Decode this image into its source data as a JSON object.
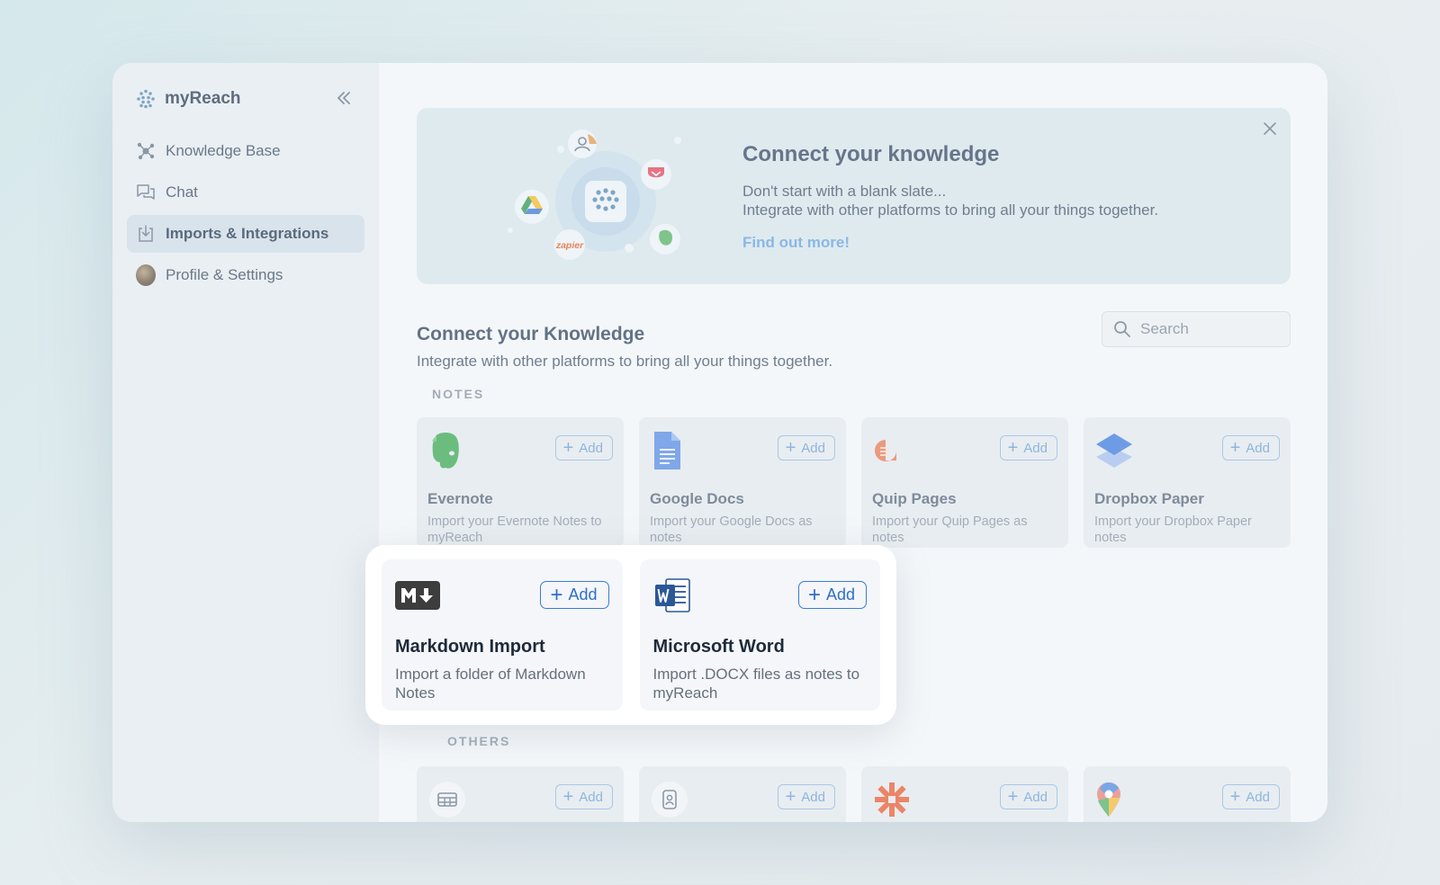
{
  "brand": {
    "name": "myReach"
  },
  "sidebar": {
    "items": [
      {
        "label": "Knowledge Base",
        "icon": "graph-icon"
      },
      {
        "label": "Chat",
        "icon": "chat-icon"
      },
      {
        "label": "Imports & Integrations",
        "icon": "import-icon",
        "active": true
      },
      {
        "label": "Profile & Settings",
        "icon": "avatar"
      }
    ]
  },
  "hero": {
    "title": "Connect your knowledge",
    "line1": "Don't start with a blank slate...",
    "line2": "Integrate with other platforms to bring all your things together.",
    "link": "Find out more!",
    "zapier_label": "zapier"
  },
  "section": {
    "title": "Connect your Knowledge",
    "subtitle": "Integrate with other platforms to bring all your things together."
  },
  "search": {
    "placeholder": "Search"
  },
  "categories": {
    "notes": "NOTES",
    "others": "OTHERS"
  },
  "add_label": "Add",
  "notes_cards": [
    {
      "title": "Evernote",
      "desc": "Import your Evernote Notes to myReach",
      "icon": "evernote-icon"
    },
    {
      "title": "Google Docs",
      "desc": "Import your Google Docs as notes",
      "icon": "google-docs-icon"
    },
    {
      "title": "Quip Pages",
      "desc": "Import your Quip Pages as notes",
      "icon": "quip-icon"
    },
    {
      "title": "Dropbox Paper",
      "desc": "Import your Dropbox Paper notes",
      "icon": "dropbox-paper-icon"
    }
  ],
  "highlight_cards": [
    {
      "title": "Markdown Import",
      "desc": "Import a folder of Markdown Notes",
      "icon": "markdown-icon"
    },
    {
      "title": "Microsoft Word",
      "desc": "Import .DOCX files as notes to myReach",
      "icon": "word-icon"
    }
  ],
  "others_cards": [
    {
      "icon": "table-icon"
    },
    {
      "icon": "contact-card-icon"
    },
    {
      "icon": "zapier-icon"
    },
    {
      "icon": "google-maps-icon"
    }
  ],
  "colors": {
    "accent": "#2d6fcb",
    "faded_accent": "#8eb5de",
    "sidebar_active": "#d9e3ec"
  }
}
